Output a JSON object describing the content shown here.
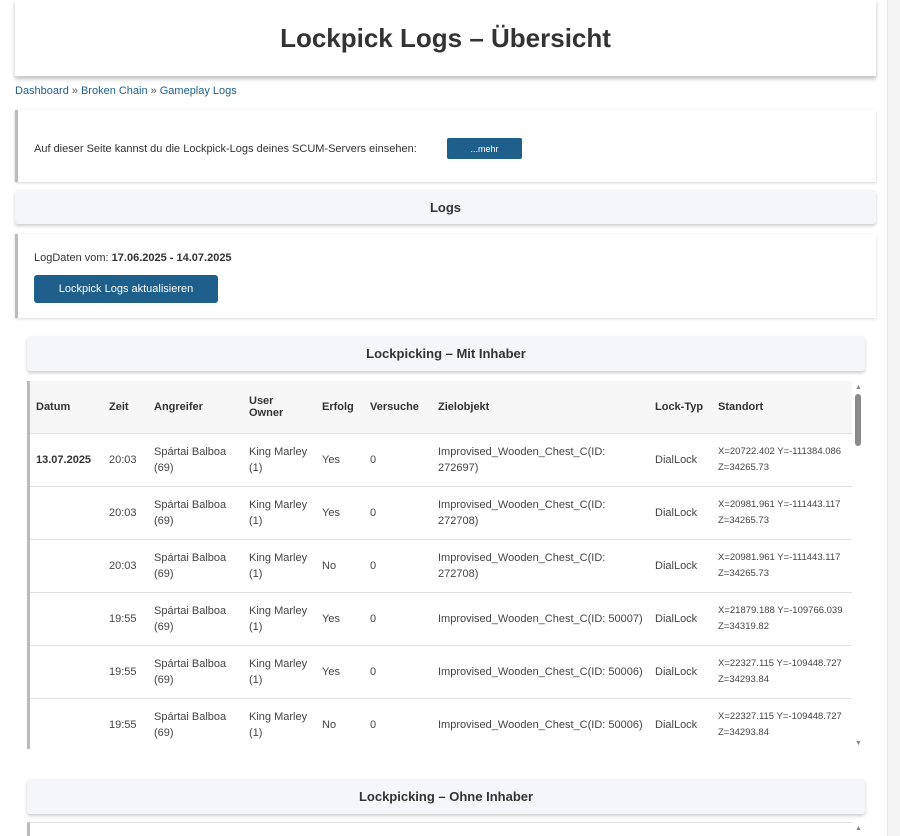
{
  "page": {
    "title": "Lockpick Logs – Übersicht"
  },
  "breadcrumb": {
    "items": [
      "Dashboard",
      "Broken Chain",
      "Gameplay Logs"
    ],
    "separator": "»"
  },
  "info": {
    "text": "Auf dieser Seite kannst du die Lockpick-Logs deines SCUM-Servers einsehen:",
    "more_button": "...mehr"
  },
  "logs_section": {
    "title": "Logs"
  },
  "date_range": {
    "label": "LogDaten vom:",
    "value": "17.06.2025 - 14.07.2025",
    "refresh_button": "Lockpick Logs aktualisieren"
  },
  "table_mit": {
    "title": "Lockpicking – Mit Inhaber",
    "headers": [
      "Datum",
      "Zeit",
      "Angreifer",
      "User Owner",
      "Erfolg",
      "Versuche",
      "Zielobjekt",
      "Lock-Typ",
      "Standort"
    ],
    "rows": [
      {
        "datum": "13.07.2025",
        "zeit": "20:03",
        "angreifer": "Spártai Balboa (69)",
        "owner": "King Marley (1)",
        "erfolg": "Yes",
        "versuche": "0",
        "ziel": "Improvised_Wooden_Chest_C(ID: 272697)",
        "lock": "DialLock",
        "standort": "X=20722.402 Y=-111384.086 Z=34265.73"
      },
      {
        "datum": "",
        "zeit": "20:03",
        "angreifer": "Spártai Balboa (69)",
        "owner": "King Marley (1)",
        "erfolg": "Yes",
        "versuche": "0",
        "ziel": "Improvised_Wooden_Chest_C(ID: 272708)",
        "lock": "DialLock",
        "standort": "X=20981.961 Y=-111443.117 Z=34265.73"
      },
      {
        "datum": "",
        "zeit": "20:03",
        "angreifer": "Spártai Balboa (69)",
        "owner": "King Marley (1)",
        "erfolg": "No",
        "versuche": "0",
        "ziel": "Improvised_Wooden_Chest_C(ID: 272708)",
        "lock": "DialLock",
        "standort": "X=20981.961 Y=-111443.117 Z=34265.73"
      },
      {
        "datum": "",
        "zeit": "19:55",
        "angreifer": "Spártai Balboa (69)",
        "owner": "King Marley (1)",
        "erfolg": "Yes",
        "versuche": "0",
        "ziel": "Improvised_Wooden_Chest_C(ID: 50007)",
        "lock": "DialLock",
        "standort": "X=21879.188 Y=-109766.039 Z=34319.82"
      },
      {
        "datum": "",
        "zeit": "19:55",
        "angreifer": "Spártai Balboa (69)",
        "owner": "King Marley (1)",
        "erfolg": "Yes",
        "versuche": "0",
        "ziel": "Improvised_Wooden_Chest_C(ID: 50006)",
        "lock": "DialLock",
        "standort": "X=22327.115 Y=-109448.727 Z=34293.84"
      },
      {
        "datum": "",
        "zeit": "19:55",
        "angreifer": "Spártai Balboa (69)",
        "owner": "King Marley (1)",
        "erfolg": "No",
        "versuche": "0",
        "ziel": "Improvised_Wooden_Chest_C(ID: 50006)",
        "lock": "DialLock",
        "standort": "X=22327.115 Y=-109448.727 Z=34293.84"
      }
    ]
  },
  "table_ohne": {
    "title": "Lockpicking – Ohne Inhaber"
  },
  "scroll_glyphs": {
    "up": "▲",
    "down": "▼"
  },
  "colors": {
    "accent": "#1f5f8c",
    "section_bg": "#f4f6f9"
  }
}
